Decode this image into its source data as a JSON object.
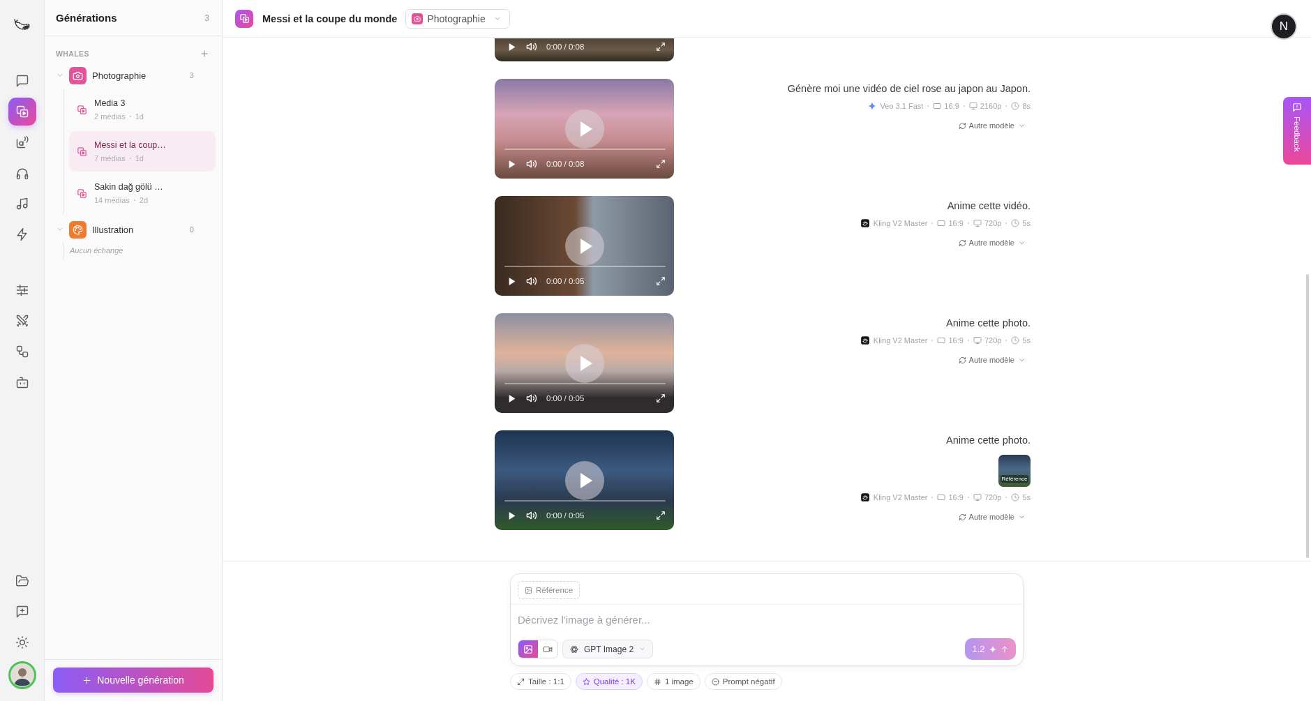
{
  "rail": {
    "top": [
      {
        "kind": "chat",
        "selected": false
      },
      {
        "kind": "media",
        "selected": true
      },
      {
        "kind": "voice",
        "selected": false
      },
      {
        "kind": "audio",
        "selected": false
      },
      {
        "kind": "music",
        "selected": false
      },
      {
        "kind": "bolt",
        "selected": false
      }
    ],
    "tools": [
      {
        "kind": "sliders",
        "selected": false
      },
      {
        "kind": "swords",
        "selected": false
      },
      {
        "kind": "workflow",
        "selected": false
      },
      {
        "kind": "robot",
        "selected": false
      }
    ],
    "bottom": [
      {
        "kind": "folder",
        "selected": false
      },
      {
        "kind": "feedback",
        "selected": false
      },
      {
        "kind": "theme",
        "selected": false
      }
    ]
  },
  "sidebar": {
    "title": "Générations",
    "count": "3",
    "section": "WHALES",
    "folders": [
      {
        "name": "Photographie",
        "count": "3",
        "kind": "camera",
        "color": "#e0559a",
        "expanded": true,
        "items": [
          {
            "title": "Media 3",
            "media": "2 médias",
            "age": "1d",
            "selected": false
          },
          {
            "title": "Messi et la coup…",
            "media": "7 médias",
            "age": "1d",
            "selected": true
          },
          {
            "title": "Sakin dağ gölü …",
            "media": "14 médias",
            "age": "2d",
            "selected": false
          }
        ]
      },
      {
        "name": "Illustration",
        "count": "0",
        "kind": "palette",
        "color": "#f07b2e",
        "expanded": true,
        "empty": "Aucun échange"
      }
    ],
    "new_button": "Nouvelle génération"
  },
  "header": {
    "title": "Messi et la coupe du monde",
    "category": {
      "label": "Photographie",
      "kind": "camera"
    },
    "account": "N"
  },
  "feedback": "Feedback",
  "messages": [
    {
      "video": {
        "time": "0:00 / 0:08",
        "cut_off": true
      }
    },
    {
      "video": {
        "time": "0:00 / 0:08",
        "cut_off": false
      },
      "prompt": "Génère moi une vidéo de ciel rose au japon au Japon.",
      "model": {
        "name": "Veo 3.1 Fast",
        "kind": "veo"
      },
      "aspect": "16:9",
      "resolution": "2160p",
      "duration": "8s",
      "action": "Autre modèle"
    },
    {
      "video": {
        "time": "0:00 / 0:05",
        "cut_off": false
      },
      "prompt": "Anime cette vidéo.",
      "model": {
        "name": "Kling V2 Master",
        "kind": "kling"
      },
      "aspect": "16:9",
      "resolution": "720p",
      "duration": "5s",
      "action": "Autre modèle"
    },
    {
      "video": {
        "time": "0:00 / 0:05",
        "cut_off": false
      },
      "prompt": "Anime cette photo.",
      "model": {
        "name": "Kling V2 Master",
        "kind": "kling"
      },
      "aspect": "16:9",
      "resolution": "720p",
      "duration": "5s",
      "action": "Autre modèle"
    },
    {
      "video": {
        "time": "0:00 / 0:05",
        "cut_off": false
      },
      "prompt": "Anime cette photo.",
      "reference": "Référence",
      "model": {
        "name": "Kling V2 Master",
        "kind": "kling"
      },
      "aspect": "16:9",
      "resolution": "720p",
      "duration": "5s",
      "action": "Autre modèle"
    }
  ],
  "composer": {
    "reference": "Référence",
    "placeholder": "Décrivez l'image à générer...",
    "modes": [
      {
        "kind": "image",
        "selected": true
      },
      {
        "kind": "video",
        "selected": false
      }
    ],
    "model": "GPT Image 2",
    "send": {
      "credits": "1.2",
      "disabled": true
    },
    "options": [
      {
        "kind": "size",
        "label": "Taille : 1:1",
        "active": false
      },
      {
        "kind": "quality",
        "label": "Qualité : 1K",
        "active": true
      },
      {
        "kind": "count",
        "label": "1 image",
        "active": false
      },
      {
        "kind": "negative",
        "label": "Prompt négatif",
        "active": false
      }
    ]
  }
}
